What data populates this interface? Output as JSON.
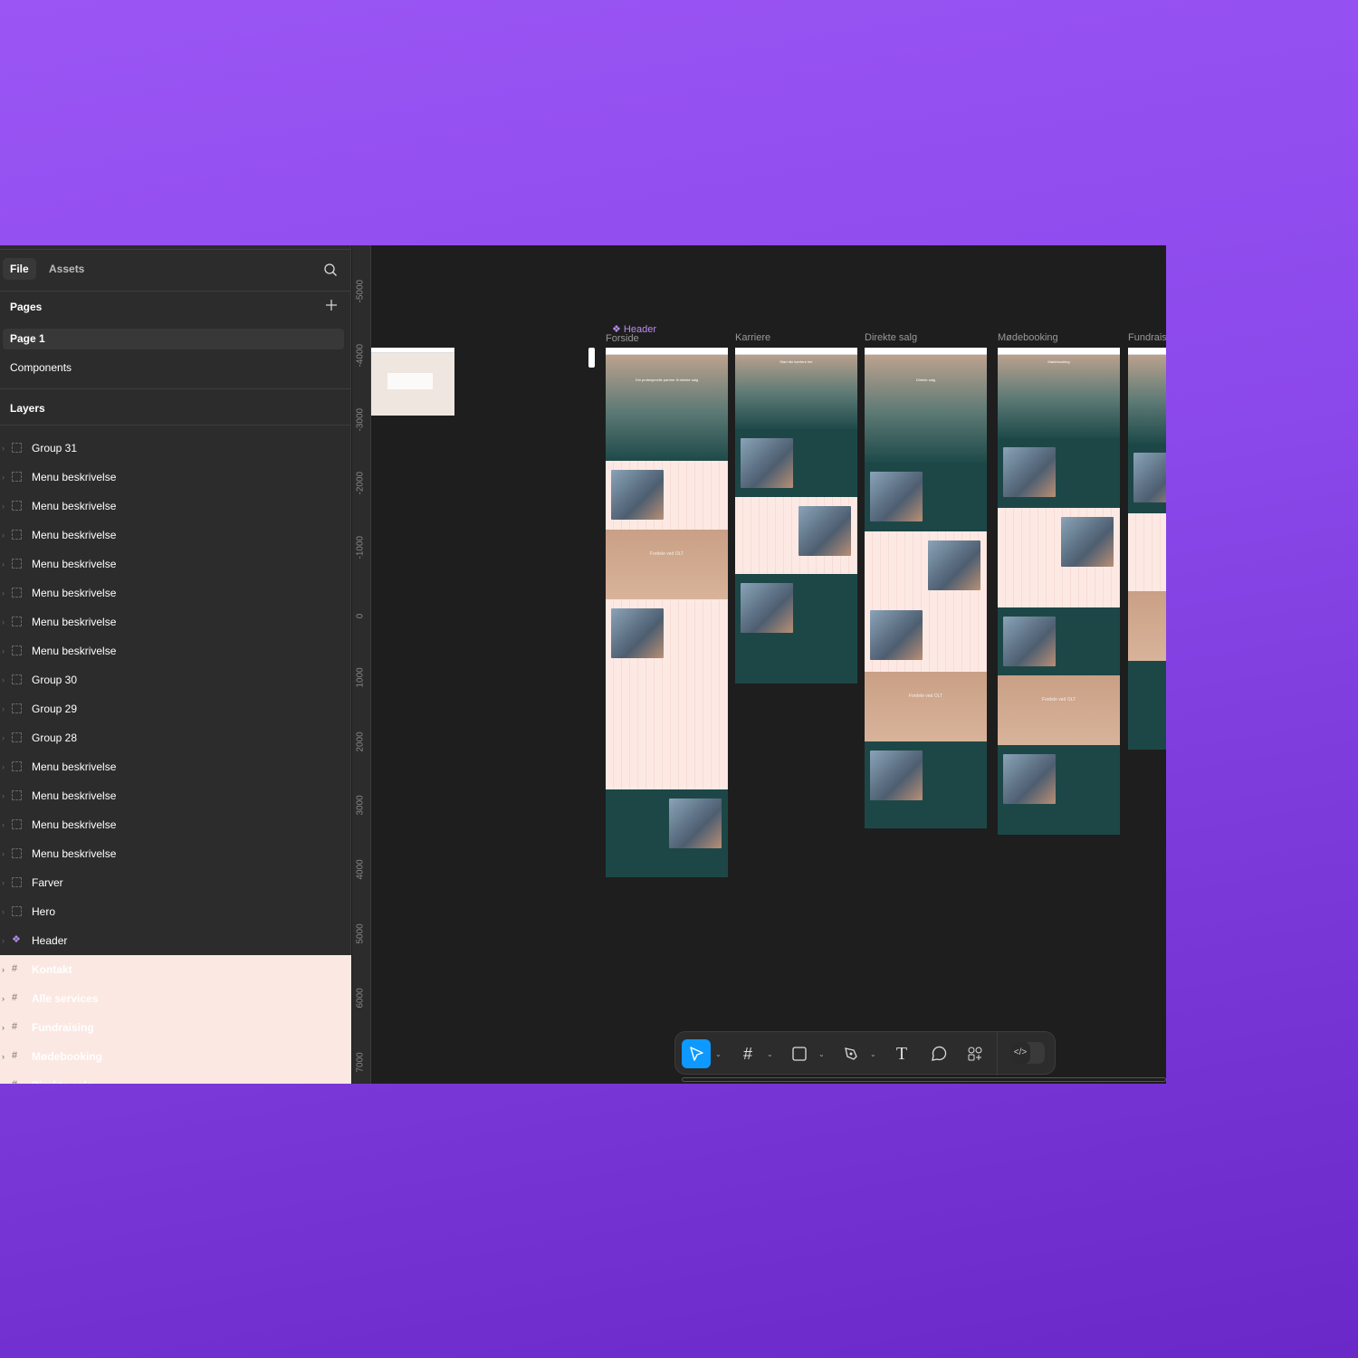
{
  "sidebar": {
    "tabs": [
      "File",
      "Assets"
    ],
    "pages_title": "Pages",
    "pages": [
      "Page 1",
      "Components"
    ],
    "layers_title": "Layers",
    "layers": [
      {
        "label": "Group 31",
        "type": "group"
      },
      {
        "label": "Menu beskrivelse",
        "type": "group"
      },
      {
        "label": "Menu beskrivelse",
        "type": "group"
      },
      {
        "label": "Menu beskrivelse",
        "type": "group"
      },
      {
        "label": "Menu beskrivelse",
        "type": "group"
      },
      {
        "label": "Menu beskrivelse",
        "type": "group"
      },
      {
        "label": "Menu beskrivelse",
        "type": "group"
      },
      {
        "label": "Menu beskrivelse",
        "type": "group"
      },
      {
        "label": "Group 30",
        "type": "group"
      },
      {
        "label": "Group 29",
        "type": "group"
      },
      {
        "label": "Group 28",
        "type": "group"
      },
      {
        "label": "Menu beskrivelse",
        "type": "group"
      },
      {
        "label": "Menu beskrivelse",
        "type": "group"
      },
      {
        "label": "Menu beskrivelse",
        "type": "group"
      },
      {
        "label": "Menu beskrivelse",
        "type": "group"
      },
      {
        "label": "Farver",
        "type": "group"
      },
      {
        "label": "Hero",
        "type": "group"
      },
      {
        "label": "Header",
        "type": "component"
      },
      {
        "label": "Kontakt",
        "type": "frame"
      },
      {
        "label": "Alle services",
        "type": "frame"
      },
      {
        "label": "Fundraising",
        "type": "frame"
      },
      {
        "label": "Mødebooking",
        "type": "frame"
      },
      {
        "label": "Direkte salg",
        "type": "frame"
      }
    ]
  },
  "ruler": [
    "-5000",
    "-4000",
    "-3000",
    "-2000",
    "-1000",
    "0",
    "1000",
    "2000",
    "3000",
    "4000",
    "5000",
    "6000",
    "7000"
  ],
  "canvas": {
    "component_label": "Header",
    "frames": [
      "Forside",
      "Karriere",
      "Direkte salg",
      "Mødebooking",
      "Fundraising"
    ],
    "hero_texts": [
      "Din profesjonelle partner til direkte salg",
      "Start din karriere her",
      "Direkte salg",
      "Mødebooking",
      "Fordele ved OLT",
      "Fordele ved OLT",
      "Fordele ved OLT"
    ]
  },
  "toolbar": {
    "tools": [
      "move",
      "frame",
      "rectangle",
      "pen",
      "text",
      "comment",
      "actions",
      "dev-mode"
    ]
  },
  "colors": {
    "accent": "#0d99ff",
    "component": "#b78cf0",
    "teal": "#1d4747",
    "pink": "#fde9e4",
    "tan": "#c9a085"
  }
}
